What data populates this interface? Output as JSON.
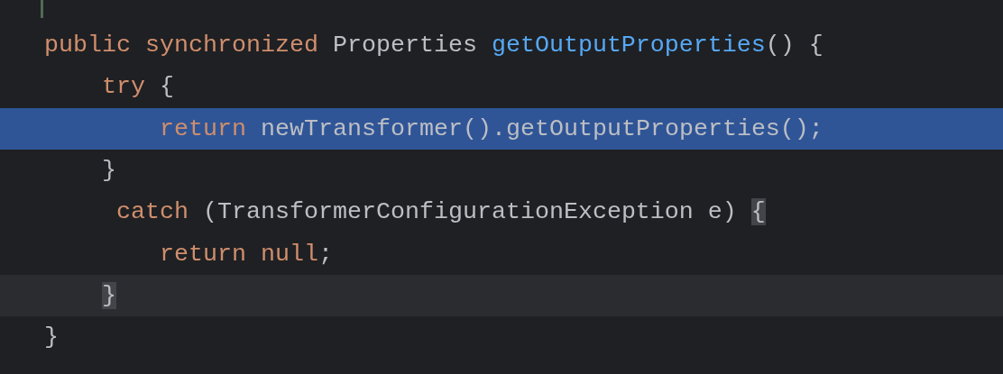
{
  "editor": {
    "lines": [
      {
        "selected": false,
        "current": false,
        "tokens": [
          {
            "kind": "keyword",
            "text": "public synchronized "
          },
          {
            "kind": "plain",
            "text": "Properties "
          },
          {
            "kind": "method",
            "text": "getOutputProperties"
          },
          {
            "kind": "plain",
            "text": "() {"
          }
        ]
      },
      {
        "selected": false,
        "current": false,
        "tokens": [
          {
            "kind": "keyword",
            "text": "    try "
          },
          {
            "kind": "plain",
            "text": "{"
          }
        ]
      },
      {
        "selected": true,
        "current": false,
        "tokens": [
          {
            "kind": "keyword",
            "text": "        return "
          },
          {
            "kind": "plain",
            "text": "newTransformer().getOutputProperties();"
          }
        ]
      },
      {
        "selected": false,
        "current": false,
        "tokens": [
          {
            "kind": "plain",
            "text": "    }"
          }
        ]
      },
      {
        "selected": false,
        "current": false,
        "tokens": [
          {
            "kind": "keyword",
            "text": "     catch "
          },
          {
            "kind": "plain",
            "text": "(TransformerConfigurationException e) "
          },
          {
            "kind": "matched-brace",
            "text": "{"
          }
        ]
      },
      {
        "selected": false,
        "current": false,
        "tokens": [
          {
            "kind": "keyword",
            "text": "        return null"
          },
          {
            "kind": "plain",
            "text": ";"
          }
        ]
      },
      {
        "selected": false,
        "current": true,
        "tokens": [
          {
            "kind": "matched-brace",
            "text": "    }"
          }
        ]
      },
      {
        "selected": false,
        "current": false,
        "tokens": [
          {
            "kind": "plain",
            "text": "}"
          }
        ]
      }
    ]
  }
}
